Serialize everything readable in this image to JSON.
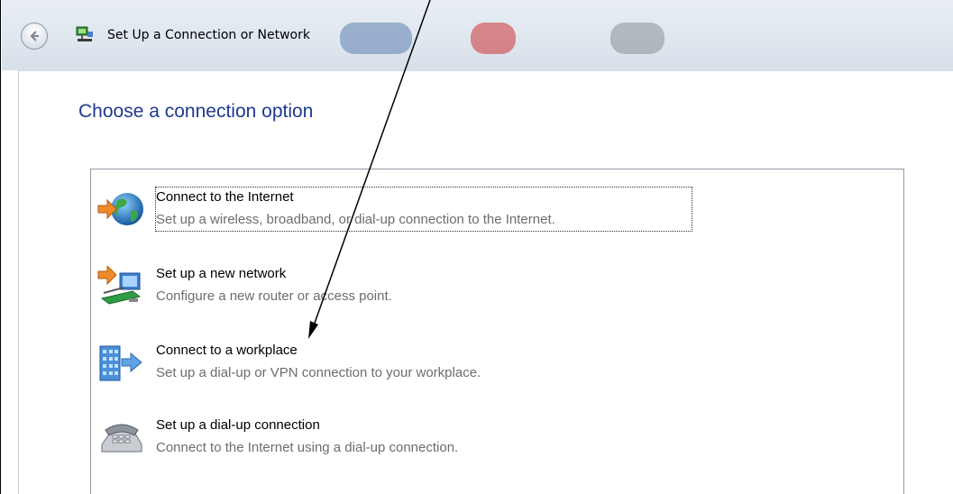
{
  "window": {
    "title": "Set Up a Connection or Network"
  },
  "main": {
    "heading": "Choose a connection option",
    "options": [
      {
        "title": "Connect to the Internet",
        "description": "Set up a wireless, broadband, or dial-up connection to the Internet.",
        "icon": "globe-icon",
        "selected": true
      },
      {
        "title": "Set up a new network",
        "description": "Configure a new router or access point.",
        "icon": "network-router-icon",
        "selected": false
      },
      {
        "title": "Connect to a workplace",
        "description": "Set up a dial-up or VPN connection to your workplace.",
        "icon": "workplace-building-icon",
        "selected": false
      },
      {
        "title": "Set up a dial-up connection",
        "description": "Connect to the Internet using a dial-up connection.",
        "icon": "telephone-icon",
        "selected": false
      }
    ]
  },
  "annotation": {
    "type": "arrow",
    "points_to": "Connect to a workplace"
  },
  "colors": {
    "heading": "#1e3a8f",
    "description": "#6d6d6d"
  }
}
